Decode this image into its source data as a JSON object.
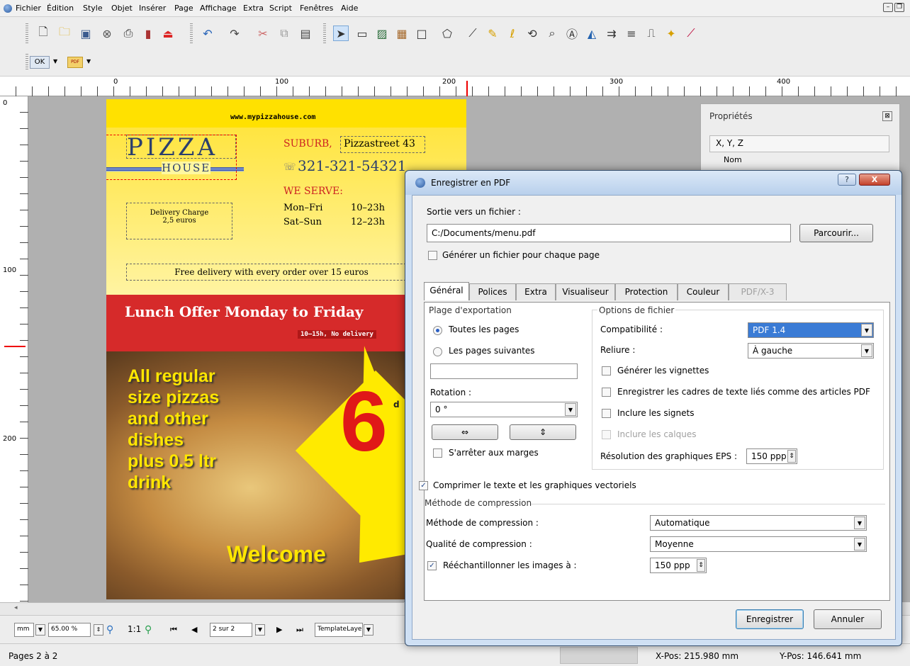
{
  "menubar": {
    "items": [
      "Fichier",
      "Édition",
      "Style",
      "Objet",
      "Insérer",
      "Page",
      "Affichage",
      "Extra",
      "Script",
      "Fenêtres",
      "Aide"
    ]
  },
  "toolbar2": {
    "ok_label": "OK",
    "pdf_label": "PDF"
  },
  "ruler": {
    "h_labels": [
      "0",
      "100",
      "200",
      "300",
      "400"
    ],
    "v_labels": [
      "0",
      "100",
      "200"
    ]
  },
  "document": {
    "url": "www.mypizzahouse.com",
    "logo_top": "PIZZA",
    "logo_bottom": "HOUSE",
    "address_suburb": "SUBURB,",
    "address_street": "Pizzastreet 43",
    "phone": "321-321-54321",
    "we_serve": "WE SERVE:",
    "hours": [
      {
        "day": "Mon–Fri",
        "time": "10–23h"
      },
      {
        "day": "Sat–Sun",
        "time": "12–23h"
      }
    ],
    "delivery_charge": "Delivery Charge",
    "delivery_price": "2,5 euros",
    "free_delivery": "Free delivery with every order over 15 euros",
    "lunch_offer": "Lunch Offer Monday to Friday",
    "lunch_sub": "10–15h, No delivery",
    "promo_lines": [
      "All regular",
      "size pizzas",
      "and other",
      "dishes",
      "plus 0.5 ltr",
      "drink"
    ],
    "price": "6",
    "price_suffix": "d",
    "welcome": "Welcome"
  },
  "properties": {
    "title": "Propriétés",
    "xyz": "X, Y, Z",
    "name": "Nom"
  },
  "dialog": {
    "title": "Enregistrer en PDF",
    "output_label": "Sortie vers un fichier :",
    "file_path": "C:/Documents/menu.pdf",
    "browse": "Parcourir...",
    "per_page": "Générer un fichier pour chaque page",
    "tabs": [
      "Général",
      "Polices",
      "Extra",
      "Visualiseur",
      "Protection",
      "Couleur",
      "PDF/X-3"
    ],
    "export_range": "Plage d'exportation",
    "all_pages": "Toutes les pages",
    "following_pages": "Les pages suivantes",
    "rotation": "Rotation :",
    "rotation_value": "0 °",
    "stop_margins": "S'arrêter aux marges",
    "file_options": "Options de fichier",
    "compat": "Compatibilité :",
    "compat_value": "PDF 1.4",
    "binding": "Reliure :",
    "binding_value": "À gauche",
    "thumbnails": "Générer les vignettes",
    "save_linked": "Enregistrer les cadres de texte liés comme des articles PDF",
    "bookmarks": "Inclure les signets",
    "layers": "Inclure les calques",
    "eps_res": "Résolution des graphiques EPS :",
    "eps_value": "150 ppp",
    "compress_text": "Comprimer le texte et les graphiques vectoriels",
    "compress_group": "Méthode de compression",
    "compress_method": "Méthode de compression :",
    "compress_method_value": "Automatique",
    "compress_quality": "Qualité de compression :",
    "compress_quality_value": "Moyenne",
    "resample": "Rééchantillonner les images à :",
    "resample_value": "150 ppp",
    "save": "Enregistrer",
    "cancel": "Annuler",
    "help": "?",
    "close": "X"
  },
  "bottombar": {
    "unit": "mm",
    "zoom": "65.00 %",
    "ratio": "1:1",
    "page": "2 sur 2",
    "layer": "TemplateLaye"
  },
  "status": {
    "pages": "Pages 2 à 2",
    "xpos": "X-Pos:  215.980 mm",
    "ypos": "Y-Pos:  146.641 mm"
  }
}
